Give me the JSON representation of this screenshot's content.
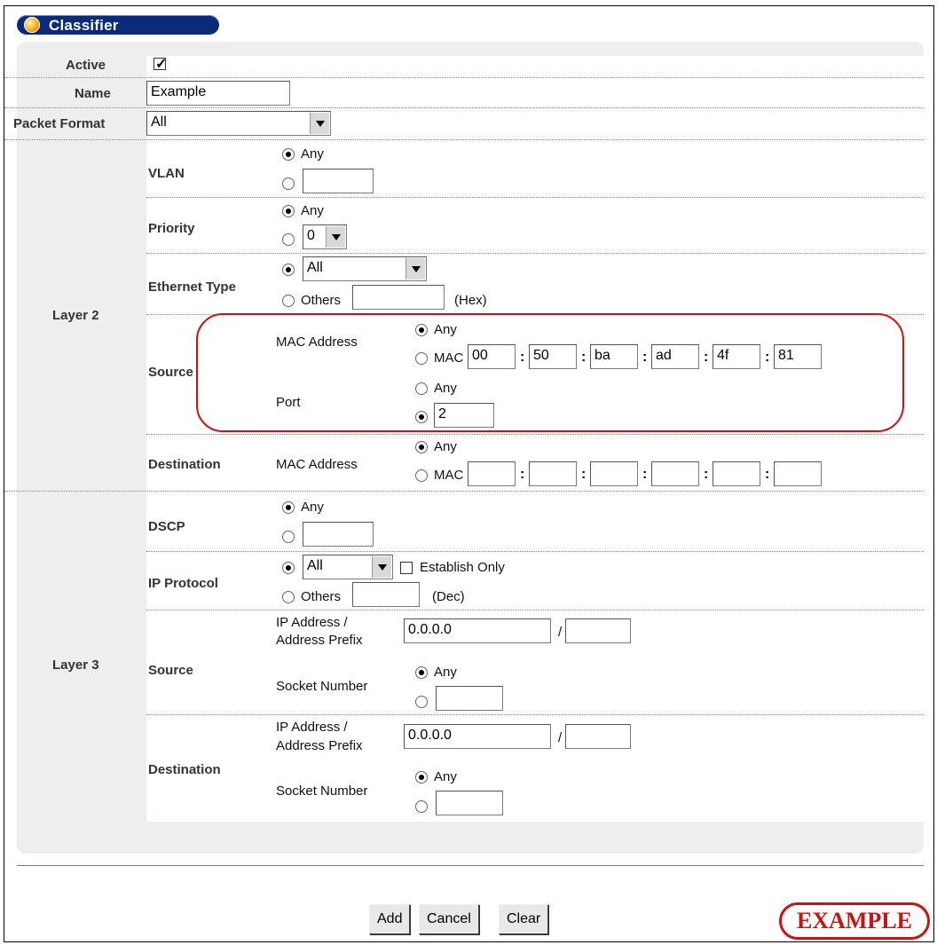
{
  "header": {
    "title": "Classifier"
  },
  "form": {
    "active": {
      "label": "Active",
      "checked": true
    },
    "name": {
      "label": "Name",
      "value": "Example"
    },
    "packet_format": {
      "label": "Packet Format",
      "value": "All"
    },
    "layer2": {
      "label": "Layer 2",
      "vlan": {
        "label": "VLAN",
        "any_label": "Any"
      },
      "priority": {
        "label": "Priority",
        "any_label": "Any",
        "value": "0"
      },
      "ethernet_type": {
        "label": "Ethernet Type",
        "select_value": "All",
        "others_label": "Others",
        "hex_label": "(Hex)"
      },
      "source": {
        "label": "Source",
        "mac_label": "MAC Address",
        "any_label": "Any",
        "mac_prefix": "MAC",
        "mac_octets": [
          "00",
          "50",
          "ba",
          "ad",
          "4f",
          "81"
        ],
        "port_label": "Port",
        "port_any_label": "Any",
        "port_value": "2"
      },
      "destination": {
        "label": "Destination",
        "mac_label": "MAC Address",
        "any_label": "Any",
        "mac_prefix": "MAC"
      }
    },
    "layer3": {
      "label": "Layer 3",
      "dscp": {
        "label": "DSCP",
        "any_label": "Any"
      },
      "ip_protocol": {
        "label": "IP Protocol",
        "select_value": "All",
        "establish_label": "Establish Only",
        "others_label": "Others",
        "dec_label": "(Dec)"
      },
      "source": {
        "label": "Source",
        "ip_label_1": "IP Address /",
        "ip_label_2": "Address Prefix",
        "ip_value": "0.0.0.0",
        "slash": "/",
        "socket_label": "Socket Number",
        "any_label": "Any"
      },
      "destination": {
        "label": "Destination",
        "ip_label_1": "IP Address /",
        "ip_label_2": "Address Prefix",
        "ip_value": "0.0.0.0",
        "slash": "/",
        "socket_label": "Socket Number",
        "any_label": "Any"
      }
    }
  },
  "buttons": {
    "add": "Add",
    "cancel": "Cancel",
    "clear": "Clear"
  },
  "stamp": "EXAMPLE"
}
